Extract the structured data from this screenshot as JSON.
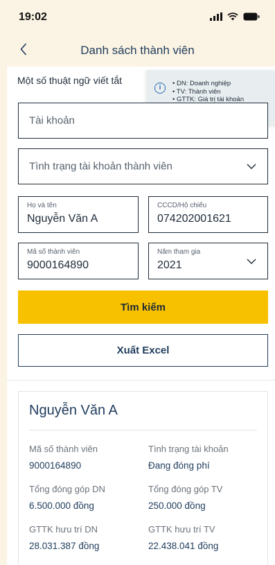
{
  "status": {
    "time": "19:02"
  },
  "nav": {
    "title": "Danh sách thành viên"
  },
  "abbr": {
    "label": "Một số thuật ngữ viết tắt",
    "items": [
      "DN: Doanh nghiệp",
      "TV: Thành viên",
      "GTTK:  Giá trị tài khoản"
    ]
  },
  "form": {
    "account_placeholder": "Tài khoản",
    "status_placeholder": "Tình trạng tài khoản thành viên",
    "name_label": "Họ và tên",
    "name_value": "Nguyễn Văn A",
    "id_label": "CCCD/Hộ chiếu",
    "id_value": "074202001621",
    "member_label": "Mã số thành viên",
    "member_value": "9000164890",
    "year_label": "Năm tham gia",
    "year_value": "2021"
  },
  "buttons": {
    "search": "Tìm kiếm",
    "export": "Xuất Excel"
  },
  "card": {
    "name": "Nguyễn Văn A",
    "fields": [
      {
        "label": "Mã số thành viên",
        "value": "9000164890"
      },
      {
        "label": "Tình trạng tài khoản",
        "value": "Đang đóng phí"
      },
      {
        "label": "Tổng đóng góp DN",
        "value": "6.500.000 đồng"
      },
      {
        "label": "Tổng đóng góp TV",
        "value": "250.000 đồng"
      },
      {
        "label": "GTTK hưu trí DN",
        "value": "28.031.387 đồng"
      },
      {
        "label": "GTTK hưu trí TV",
        "value": "22.438.041 đồng"
      }
    ]
  },
  "icons": [
    "chevron-left-icon",
    "info-icon",
    "chevron-down-icon",
    "signal-icon",
    "wifi-icon",
    "battery-icon"
  ],
  "colors": {
    "primary": "#F7C100",
    "navy": "#1F3C5C",
    "background": "#FBF3E3"
  }
}
